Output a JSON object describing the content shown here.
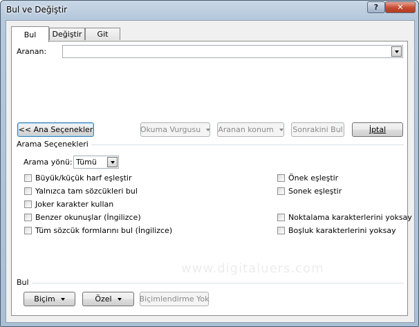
{
  "window": {
    "title": "Bul ve Değiştir",
    "help_label": "?",
    "close_label": "✕"
  },
  "tabs": [
    {
      "label": "Bul",
      "active": true
    },
    {
      "label": "Değiştir",
      "active": false
    },
    {
      "label": "Git",
      "active": false
    }
  ],
  "search": {
    "label": "Aranan:",
    "value": ""
  },
  "buttons": {
    "less_options": "<< Ana Seçenekler",
    "reading_highlight": "Okuma Vurgusu",
    "find_in": "Aranan konum",
    "find_next": "Sonrakini Bul",
    "cancel": "İptal"
  },
  "options": {
    "section_title": "Arama Seçenekleri",
    "direction_label": "Arama yönü:",
    "direction_value": "Tümü",
    "left": [
      {
        "label": "Büyük/küçük harf eşleştir",
        "checked": false
      },
      {
        "label": "Yalnızca tam sözcükleri bul",
        "checked": false
      },
      {
        "label": "Joker karakter kullan",
        "checked": false
      },
      {
        "label": "Benzer okunuşlar (İngilizce)",
        "checked": false
      },
      {
        "label": "Tüm sözcük formlarını bul (İngilizce)",
        "checked": false
      }
    ],
    "right": [
      {
        "label": "Önek eşleştir",
        "checked": false
      },
      {
        "label": "Sonek eşleştir",
        "checked": false
      },
      {
        "label": "Noktalama karakterlerini yoksay",
        "checked": false
      },
      {
        "label": "Boşluk karakterlerini yoksay",
        "checked": false
      }
    ]
  },
  "find_section": {
    "title": "Bul",
    "format_button": "Biçim",
    "special_button": "Özel",
    "no_formatting_button": "Biçimlendirme Yok"
  },
  "watermark": "www.digitaluers.com",
  "colors": {
    "title_bar": "#b5c8dc",
    "close_button": "#c44b2f",
    "dialog_bg": "#f0f0f0",
    "focus_border": "#3c7fb1"
  }
}
